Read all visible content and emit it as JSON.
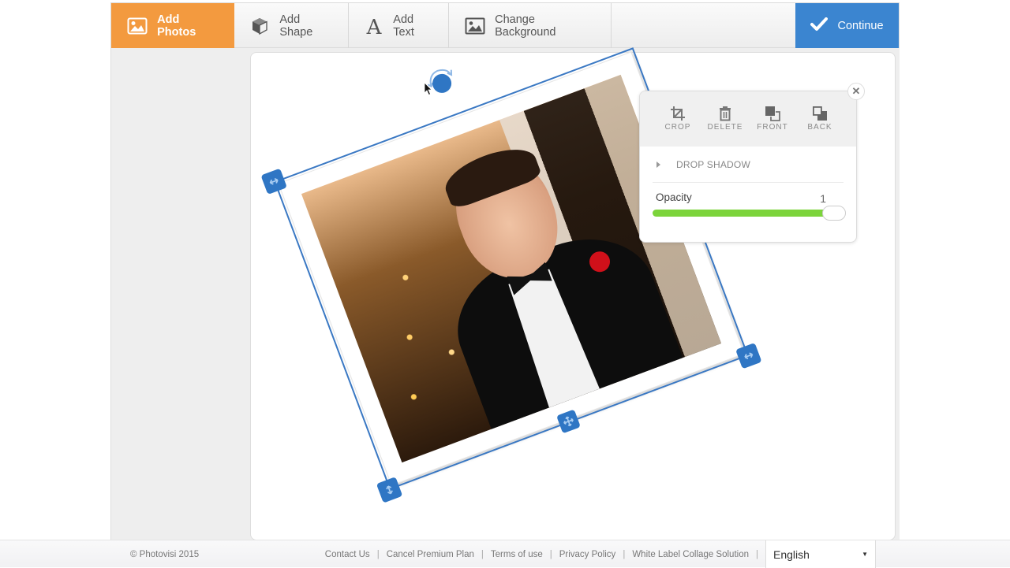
{
  "toolbar": {
    "items": [
      {
        "label": "Add Photos",
        "icon": "image-icon",
        "active": true
      },
      {
        "label": "Add Shape",
        "icon": "cube-icon",
        "active": false
      },
      {
        "label": "Add Text",
        "icon": "text-a-icon",
        "active": false
      },
      {
        "label": "Change Background",
        "icon": "image-icon",
        "active": false
      }
    ],
    "continue_label": "Continue",
    "continue_icon": "checkmark-icon"
  },
  "colors": {
    "active_tab": "#f39a3f",
    "continue": "#3b85d0",
    "selection": "#2f76c4",
    "slider_fill": "#7cd43b"
  },
  "properties_panel": {
    "actions": [
      {
        "label": "CROP",
        "icon": "crop-icon"
      },
      {
        "label": "DELETE",
        "icon": "trash-icon"
      },
      {
        "label": "FRONT",
        "icon": "bring-front-icon"
      },
      {
        "label": "BACK",
        "icon": "send-back-icon"
      }
    ],
    "drop_shadow_label": "DROP SHADOW",
    "opacity_label": "Opacity",
    "opacity_value": "1",
    "opacity_fraction": 1.0,
    "close_icon": "close-icon"
  },
  "canvas": {
    "selected_element": "photo",
    "rotation_deg": -20.5
  },
  "footer": {
    "copyright": "© Photovisi 2015",
    "links": [
      "Contact Us",
      "Cancel Premium Plan",
      "Terms of use",
      "Privacy Policy",
      "White Label Collage Solution"
    ],
    "language": "English"
  }
}
